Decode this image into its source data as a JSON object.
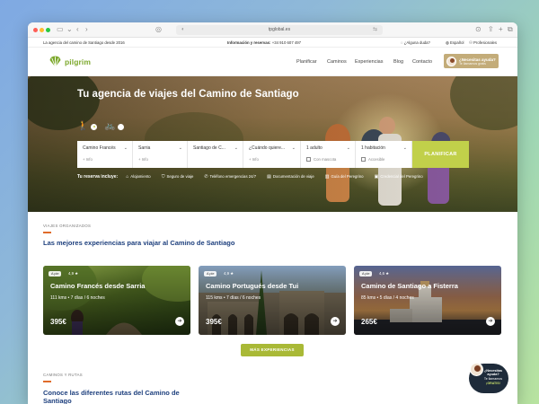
{
  "browser": {
    "url": "tpglobal.es"
  },
  "infobar": {
    "tagline": "La agencia del camino de Santiago desde 2016",
    "contact_label": "Información y reservas:",
    "phone": "+34 910 607 497",
    "help": "¿Alguna duda?",
    "language": "Español",
    "professionals": "Profesionales"
  },
  "nav": {
    "logo_text": "pilgrim",
    "links": [
      "Planificar",
      "Caminos",
      "Experiencias",
      "Blog",
      "Contacto"
    ],
    "help_title": "¿Necesitas ayuda?",
    "help_sub": "Te llamamos gratis"
  },
  "hero": {
    "title": "Tu agencia de viajes del Camino de Santiago",
    "search": {
      "route": {
        "value": "Camino Francés",
        "sub": "+ Info"
      },
      "start": {
        "value": "Sarria",
        "sub": "+ Info"
      },
      "end": {
        "value": "Santiago de C...",
        "sub": ""
      },
      "date": {
        "value": "¿Cuándo quiere...",
        "sub": "+ Info"
      },
      "people": {
        "value": "1 adulto",
        "sub": "Con mascota"
      },
      "rooms": {
        "value": "1 habitación",
        "sub": "Accesible"
      },
      "submit": "PLANIFICAR"
    },
    "includes_label": "Tu reserva incluye:",
    "includes": [
      "Alojamiento",
      "Seguro de viaje",
      "Teléfono emergencias 24/7",
      "Documentación de viaje",
      "Guía del Peregrino",
      "Credencial del Peregrino"
    ]
  },
  "organized": {
    "overline": "VIAJES ORGANIZADOS",
    "title": "Las mejores experiencias para viajar al Camino de Santiago",
    "cards": [
      {
        "tag": "A pie",
        "rating": "4,9 ★",
        "title": "Camino Francés desde Sarria",
        "meta": "111 kms • 7 días / 6 noches",
        "price": "395€"
      },
      {
        "tag": "A pie",
        "rating": "4,9 ★",
        "title": "Camino Portugués desde Tui",
        "meta": "115 kms • 7 días / 6 noches",
        "price": "395€"
      },
      {
        "tag": "A pie",
        "rating": "4,6 ★",
        "title": "Camino de Santiago a Fisterra",
        "meta": "85 kms • 5 días / 4 noches",
        "price": "265€"
      }
    ],
    "more_button": "MÁS EXPERIENCIAS"
  },
  "routes": {
    "overline": "CAMINOS Y RUTAS",
    "title_line1": "Conoce las diferentes rutas del Camino de",
    "title_line2": "Santiago"
  },
  "chat": {
    "line1": "¿Necesitas ayuda?",
    "line2": "Te llamamos",
    "line3": "¡GRATIS!"
  },
  "colors": {
    "brand_green": "#7ca82c",
    "accent_lime": "#c1d04a",
    "title_blue": "#1d3f7d",
    "accent_orange": "#e06b2a",
    "help_gold": "#c3ac79"
  }
}
